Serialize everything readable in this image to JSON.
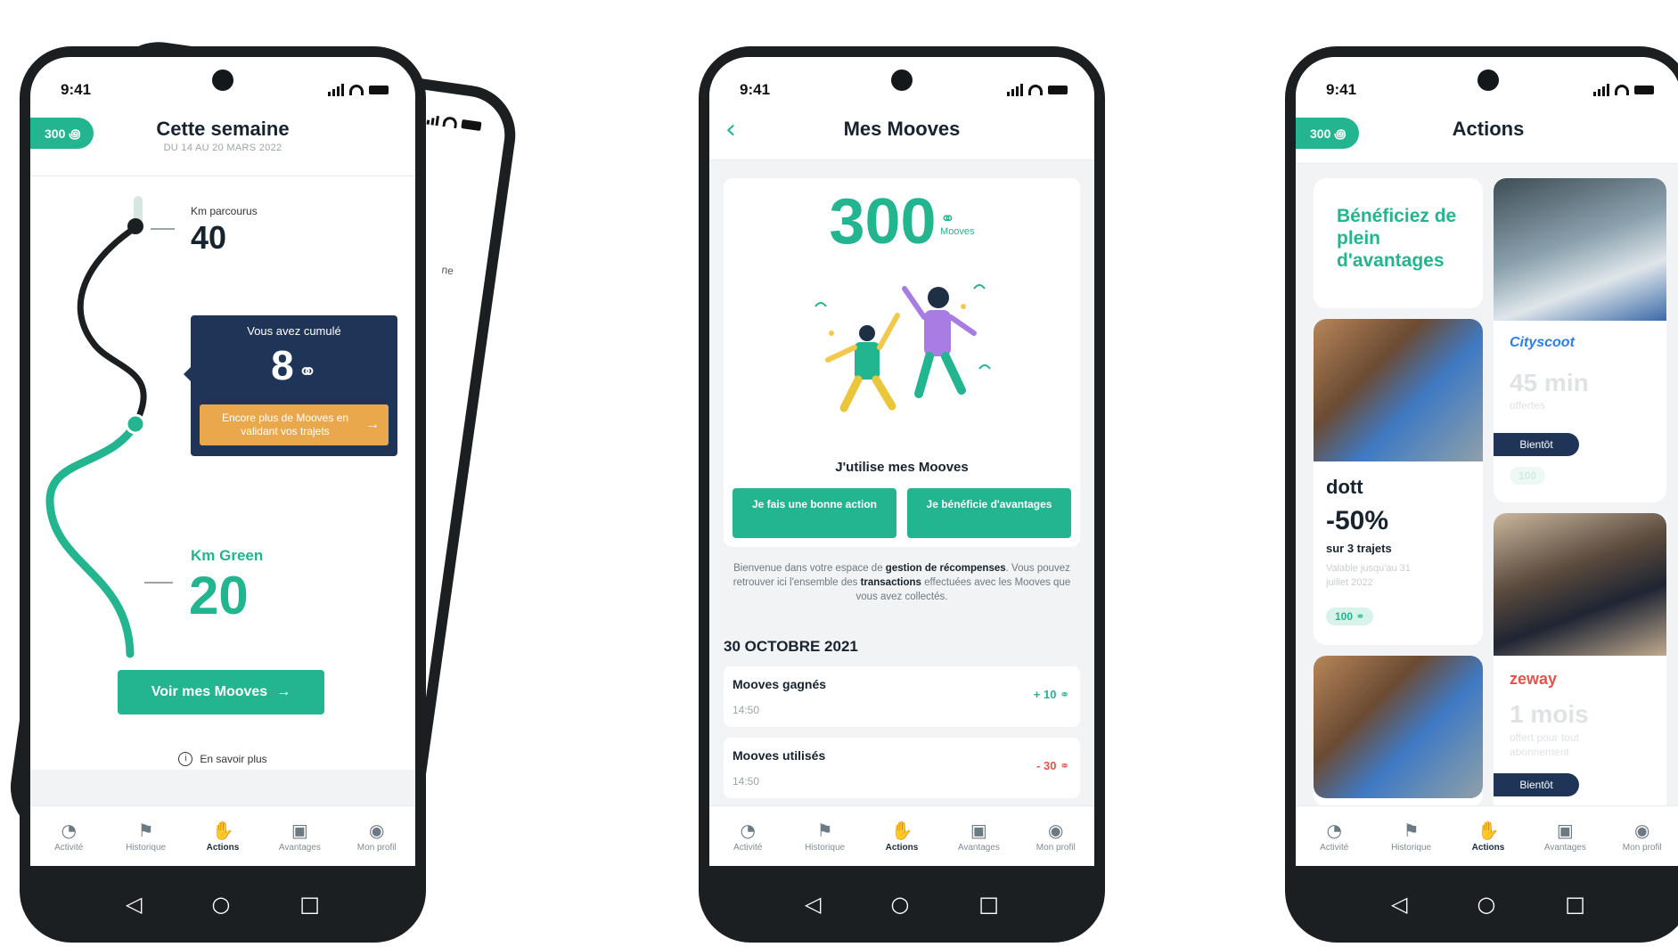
{
  "status": {
    "time": "9:41"
  },
  "tabbar": [
    {
      "label": "Activité",
      "icon": "speedometer-icon"
    },
    {
      "label": "Historique",
      "icon": "signpost-icon"
    },
    {
      "label": "Actions",
      "icon": "actions-icon"
    },
    {
      "label": "Avantages",
      "icon": "ticket-icon"
    },
    {
      "label": "Mon profil",
      "icon": "profile-icon"
    }
  ],
  "week_screen": {
    "pill": "300 ꩜",
    "title": "Cette semaine",
    "subtitle": "DU 14 AU 20 MARS 2022",
    "km_label": "Km parcourus",
    "km_value": "40",
    "callout_title": "Vous avez cumulé",
    "callout_value": "8",
    "callout_cta": "Encore plus de Mooves en validant vos trajets",
    "green_label": "Km Green",
    "green_value": "20",
    "primary_button": "Voir mes Mooves",
    "info_link": "En savoir plus",
    "back_card_text": "ne"
  },
  "mooves_screen": {
    "title": "Mes Mooves",
    "total": "300",
    "unit": "Mooves",
    "use_heading": "J'utilise mes Mooves",
    "button_left": "Je fais une bonne action",
    "button_right": "Je bénéficie d'avantages",
    "intro_parts": [
      "Bienvenue dans votre espace de ",
      "gestion de récompenses",
      ". Vous pouvez retrouver ici l'ensemble des ",
      "transactions",
      " effectuées avec les Mooves que vous avez collectés."
    ],
    "date_heading": "30 OCTOBRE 2021",
    "transactions": [
      {
        "label": "Mooves gagnés",
        "time": "14:50",
        "amount": "+ 10",
        "color": "#22b58f"
      },
      {
        "label": "Mooves utilisés",
        "time": "14:50",
        "amount": "- 30",
        "color": "#e5534b"
      }
    ]
  },
  "actions_screen": {
    "pill": "300 ꩜",
    "title": "Actions",
    "hero": "Bénéficiez de plein d'avantages",
    "dott": {
      "brand": "dott",
      "discount": "-50%",
      "detail": "sur 3 trajets",
      "validity": "Valable jusqu'au 31 juillet 2022",
      "cost": "100"
    },
    "cityscoot": {
      "brand": "Cityscoot",
      "offer": "45 min",
      "detail": "offertes",
      "badge": "Bientôt",
      "cost": "100"
    },
    "zeway": {
      "brand": "zeway",
      "offer": "1 mois",
      "detail": "offert pour tout abonnement",
      "badge": "Bientôt"
    }
  },
  "nav": {
    "back": "◁",
    "home": "○",
    "recent": "□"
  },
  "colors": {
    "accent": "#22b58f",
    "navy": "#1f3557",
    "orange": "#e9a84c",
    "red": "#e5534b",
    "frame": "#1c1f22"
  }
}
